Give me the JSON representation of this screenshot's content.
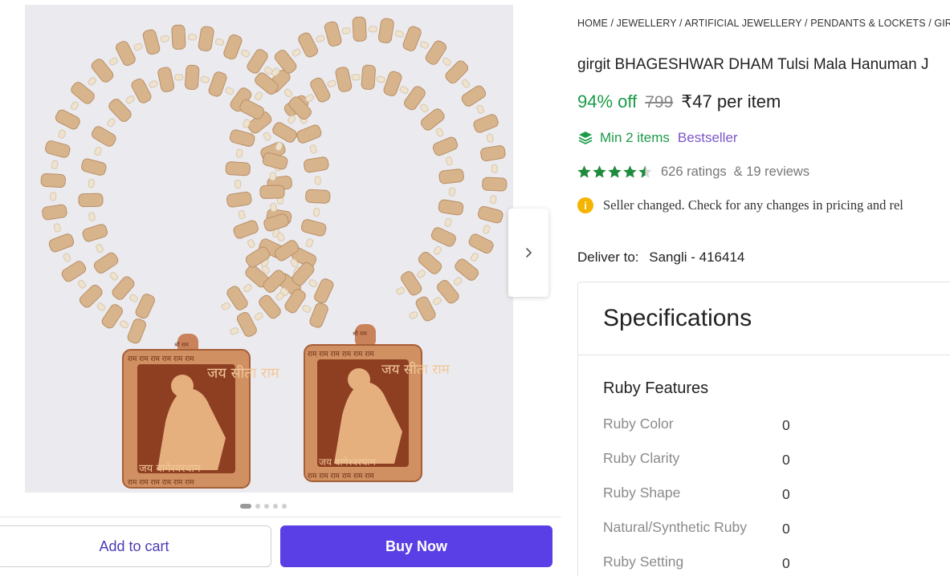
{
  "breadcrumb": {
    "items": [
      "HOME",
      "JEWELLERY",
      "ARTIFICIAL JEWELLERY",
      "PENDANTS & LOCKETS",
      "GIRG"
    ],
    "separator": " / "
  },
  "product": {
    "title": "girgit BHAGESHWAR DHAM Tulsi Mala Hanuman J",
    "discount": "94% off",
    "mrp": "799",
    "price": "₹47 per item",
    "min_items": "Min 2 items",
    "badge": "Bestseller",
    "rating": 4.5,
    "ratings_count": "626 ratings",
    "reviews_count": "& 19 reviews",
    "notice": "Seller changed. Check for any changes in pricing and rel",
    "pendant_text_top": "जय सीता राम",
    "pendant_text_bottom": "जय बागेश्वरधाम",
    "pendant_header": "श्री राम",
    "pendant_border_word": "राम"
  },
  "delivery": {
    "label": "Deliver to:",
    "location": "Sangli - 416414"
  },
  "gallery": {
    "dot_count": 5,
    "active_index": 0
  },
  "actions": {
    "add_to_cart": "Add to cart",
    "buy_now": "Buy Now"
  },
  "specifications": {
    "heading": "Specifications",
    "section": "Ruby Features",
    "rows": [
      {
        "label": "Ruby Color",
        "value": "0"
      },
      {
        "label": "Ruby Clarity",
        "value": "0"
      },
      {
        "label": "Ruby Shape",
        "value": "0"
      },
      {
        "label": "Natural/Synthetic Ruby",
        "value": "0"
      },
      {
        "label": "Ruby Setting",
        "value": "0"
      }
    ]
  },
  "colors": {
    "discount_green": "#1b9b48",
    "bestseller_purple": "#7b55c8",
    "buy_button": "#5a3ee6",
    "cart_text": "#4b3bb8",
    "star_green": "#1f8a3e",
    "info_yellow": "#f5b400"
  },
  "icons": {
    "next": "chevron-right-icon",
    "min_items": "layers-icon",
    "notice": "info-icon",
    "star": "star-icon"
  }
}
